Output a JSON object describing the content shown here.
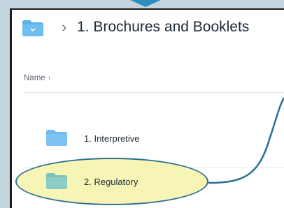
{
  "breadcrumb": {
    "folder_icon": "folder-icon",
    "separator": "›",
    "title": "1. Brochures and Booklets"
  },
  "table": {
    "column_header": "Name",
    "sort_indicator": "↑",
    "rows": [
      {
        "label": "1. Interpretive",
        "icon": "folder-icon",
        "color": "#7dc3f2"
      },
      {
        "label": "2. Regulatory",
        "icon": "folder-icon",
        "color": "#8ccdc6",
        "highlighted": true
      }
    ]
  },
  "colors": {
    "folder_blue": "#7dc3f2",
    "folder_teal": "#8ccdc6",
    "highlight_fill": "#f6f5b6",
    "annotation_stroke": "#2b6f95"
  }
}
